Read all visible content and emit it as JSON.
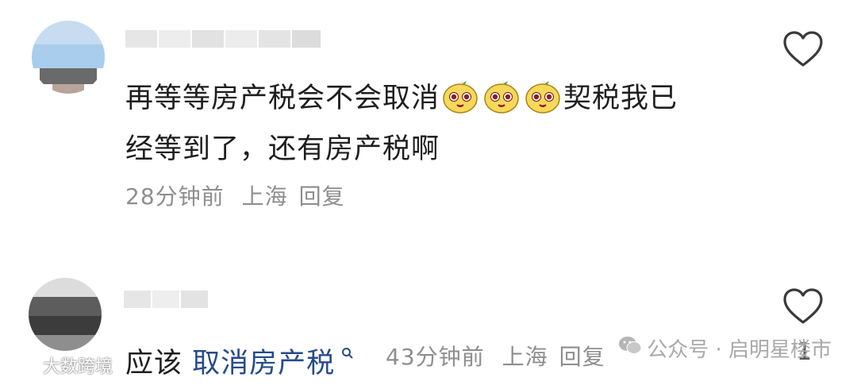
{
  "comments": [
    {
      "text_line1": "再等等房产税会不会取消",
      "emoji_count": 3,
      "emoji_name": "yellow-pear-face",
      "text_after_emoji": "契税我已",
      "text_line2": "经等到了，还有房产税啊",
      "time": "28分钟前",
      "location": "上海",
      "reply_label": "回复"
    },
    {
      "text_prefix": "应该",
      "keyword": "取消房产税",
      "keyword_icon": "search-icon",
      "time": "43分钟前",
      "location": "上海",
      "reply_label": "回复",
      "like_count": "1"
    }
  ],
  "watermark_right": {
    "icon": "wechat-icon",
    "text": "公众号 · 启明星楼市"
  },
  "watermark_left": {
    "icon": "logo-icon",
    "text": "大数跨境"
  }
}
